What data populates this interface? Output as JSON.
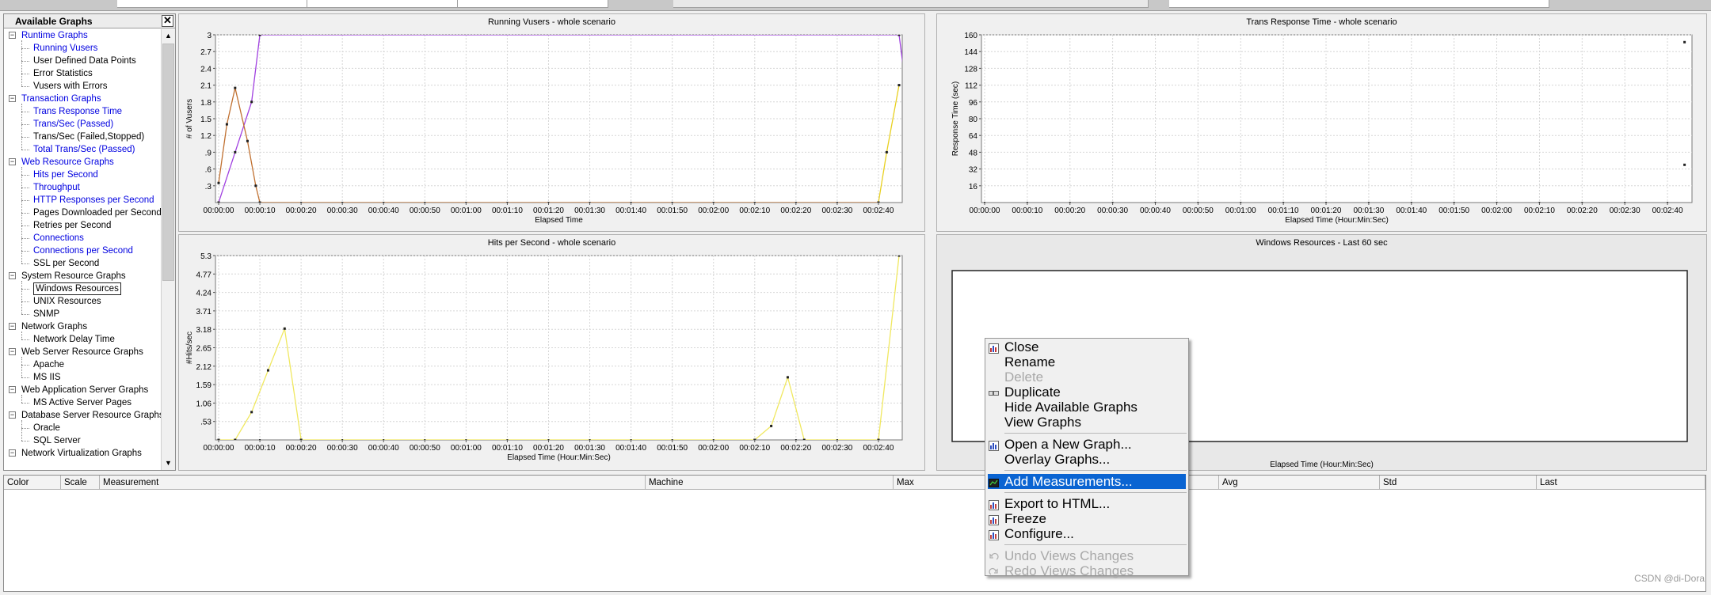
{
  "available_graphs": {
    "title": "Available Graphs",
    "close_glyph": "✕",
    "tree": [
      {
        "label": "Runtime Graphs",
        "level": 0,
        "blue": true
      },
      {
        "label": "Running Vusers",
        "level": 1,
        "blue": true
      },
      {
        "label": "User Defined Data Points",
        "level": 1,
        "blue": false
      },
      {
        "label": "Error Statistics",
        "level": 1,
        "blue": false
      },
      {
        "label": "Vusers with Errors",
        "level": 1,
        "blue": false
      },
      {
        "label": "Transaction Graphs",
        "level": 0,
        "blue": true
      },
      {
        "label": "Trans Response Time",
        "level": 1,
        "blue": true
      },
      {
        "label": "Trans/Sec (Passed)",
        "level": 1,
        "blue": true
      },
      {
        "label": "Trans/Sec (Failed,Stopped)",
        "level": 1,
        "blue": false
      },
      {
        "label": "Total Trans/Sec (Passed)",
        "level": 1,
        "blue": true
      },
      {
        "label": "Web Resource Graphs",
        "level": 0,
        "blue": true
      },
      {
        "label": "Hits per Second",
        "level": 1,
        "blue": true
      },
      {
        "label": "Throughput",
        "level": 1,
        "blue": true
      },
      {
        "label": "HTTP Responses per Second",
        "level": 1,
        "blue": true
      },
      {
        "label": "Pages Downloaded per Second",
        "level": 1,
        "blue": false
      },
      {
        "label": "Retries per Second",
        "level": 1,
        "blue": false
      },
      {
        "label": "Connections",
        "level": 1,
        "blue": true
      },
      {
        "label": "Connections per Second",
        "level": 1,
        "blue": true
      },
      {
        "label": "SSL per Second",
        "level": 1,
        "blue": false
      },
      {
        "label": "System Resource Graphs",
        "level": 0,
        "blue": false
      },
      {
        "label": "Windows Resources",
        "level": 1,
        "blue": false,
        "selected": true
      },
      {
        "label": "UNIX Resources",
        "level": 1,
        "blue": false
      },
      {
        "label": "SNMP",
        "level": 1,
        "blue": false
      },
      {
        "label": "Network Graphs",
        "level": 0,
        "blue": false
      },
      {
        "label": "Network Delay Time",
        "level": 1,
        "blue": false
      },
      {
        "label": "Web Server Resource Graphs",
        "level": 0,
        "blue": false
      },
      {
        "label": "Apache",
        "level": 1,
        "blue": false
      },
      {
        "label": "MS IIS",
        "level": 1,
        "blue": false
      },
      {
        "label": "Web Application Server Graphs",
        "level": 0,
        "blue": false
      },
      {
        "label": "MS Active Server Pages",
        "level": 1,
        "blue": false
      },
      {
        "label": "Database Server Resource Graphs",
        "level": 0,
        "blue": false
      },
      {
        "label": "Oracle",
        "level": 1,
        "blue": false
      },
      {
        "label": "SQL Server",
        "level": 1,
        "blue": false
      },
      {
        "label": "Network Virtualization Graphs",
        "level": 0,
        "blue": false
      }
    ]
  },
  "x_ticks": [
    "00:00:00",
    "00:00:10",
    "00:00:20",
    "00:00:30",
    "00:00:40",
    "00:00:50",
    "00:01:00",
    "00:01:10",
    "00:01:20",
    "00:01:30",
    "00:01:40",
    "00:01:50",
    "00:02:00",
    "00:02:10",
    "00:02:20",
    "00:02:30",
    "00:02:40"
  ],
  "chart_data": [
    {
      "type": "line",
      "title": "Running Vusers - whole scenario",
      "xlabel": "Elapsed Time",
      "ylabel": "# of Vusers",
      "yticks": [
        "3",
        "2.7",
        "2.4",
        "2.1",
        "1.8",
        "1.5",
        "1.2",
        ".9",
        ".6",
        ".3"
      ],
      "ylim": [
        0,
        3
      ],
      "xlim": [
        0,
        165
      ],
      "series": [
        {
          "color": "#a040e0",
          "points": [
            [
              0,
              0
            ],
            [
              4,
              0.9
            ],
            [
              8,
              1.8
            ],
            [
              10,
              3
            ],
            [
              165,
              3
            ],
            [
              168,
              1.3
            ]
          ]
        },
        {
          "color": "#c07030",
          "points": [
            [
              0,
              0.35
            ],
            [
              2,
              1.4
            ],
            [
              4,
              2.05
            ],
            [
              7,
              1.1
            ],
            [
              9,
              0.3
            ],
            [
              10,
              0
            ],
            [
              160,
              0
            ]
          ]
        },
        {
          "color": "#e8d020",
          "points": [
            [
              160,
              0
            ],
            [
              162,
              0.9
            ],
            [
              165,
              2.1
            ]
          ]
        }
      ]
    },
    {
      "type": "scatter",
      "title": "Trans Response Time - whole scenario",
      "xlabel": "Elapsed Time (Hour:Min:Sec)",
      "ylabel": "Response Time (sec)",
      "yticks": [
        "160",
        "144",
        "128",
        "112",
        "96",
        "80",
        "64",
        "48",
        "32",
        "16"
      ],
      "ylim": [
        0,
        160
      ],
      "xlim": [
        0,
        165
      ],
      "series": [
        {
          "color": "#208060",
          "points": [
            [
              164,
              153
            ],
            [
              164,
              36
            ]
          ]
        }
      ]
    },
    {
      "type": "line",
      "title": "Hits per Second - whole scenario",
      "xlabel": "Elapsed Time (Hour:Min:Sec)",
      "ylabel": "#Hits/sec",
      "yticks": [
        "5.3",
        "4.77",
        "4.24",
        "3.71",
        "3.18",
        "2.65",
        "2.12",
        "1.59",
        "1.06",
        ".53"
      ],
      "ylim": [
        0,
        5.3
      ],
      "xlim": [
        0,
        165
      ],
      "series": [
        {
          "color": "#f0e860",
          "points": [
            [
              0,
              0
            ],
            [
              4,
              0
            ],
            [
              8,
              0.8
            ],
            [
              12,
              2.0
            ],
            [
              16,
              3.2
            ],
            [
              20,
              0
            ],
            [
              130,
              0
            ],
            [
              134,
              0.4
            ],
            [
              138,
              1.8
            ],
            [
              142,
              0
            ],
            [
              160,
              0
            ],
            [
              165,
              5.3
            ]
          ]
        }
      ]
    },
    {
      "type": "line",
      "title": "Windows Resources - Last 60 sec",
      "xlabel": "Elapsed Time (Hour:Min:Sec)",
      "series": []
    }
  ],
  "context_menu": {
    "items": [
      {
        "label": "Close",
        "icon": "close-graph-icon",
        "disabled": false
      },
      {
        "label": "Rename",
        "disabled": false
      },
      {
        "label": "Delete",
        "disabled": true
      },
      {
        "label": "Duplicate",
        "icon": "duplicate-icon",
        "disabled": false
      },
      {
        "label": "Hide Available Graphs",
        "disabled": false
      },
      {
        "label": "View Graphs",
        "disabled": false
      },
      {
        "sep": true
      },
      {
        "label": "Open a New Graph...",
        "icon": "new-graph-icon",
        "disabled": false
      },
      {
        "label": "Overlay Graphs...",
        "disabled": false
      },
      {
        "sep": true
      },
      {
        "label": "Add Measurements...",
        "icon": "add-measurements-icon",
        "disabled": false,
        "highlighted": true
      },
      {
        "sep": true
      },
      {
        "label": "Export to HTML...",
        "icon": "export-html-icon",
        "disabled": false
      },
      {
        "label": "Freeze",
        "icon": "freeze-icon",
        "disabled": false
      },
      {
        "label": "Configure...",
        "icon": "configure-icon",
        "disabled": false
      },
      {
        "sep": true
      },
      {
        "label": "Undo Views Changes",
        "icon": "undo-icon",
        "disabled": true
      },
      {
        "label": "Redo Views Changes",
        "icon": "redo-icon",
        "disabled": true
      }
    ]
  },
  "legend_table": {
    "columns": [
      "Color",
      "Scale",
      "Measurement",
      "Machine",
      "Max",
      "Avg",
      "Std",
      "Last"
    ]
  },
  "watermark": "CSDN @di-Dora"
}
